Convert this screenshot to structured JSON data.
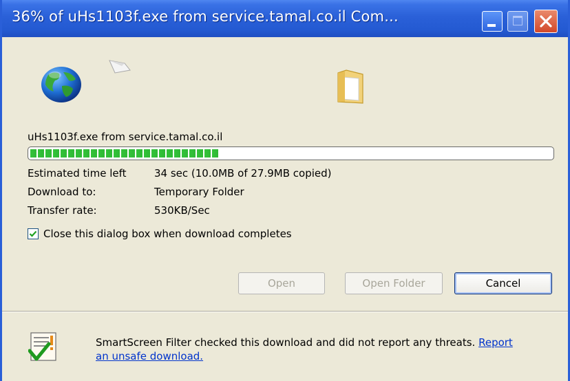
{
  "window": {
    "title": "36% of uHs1103f.exe from service.tamal.co.il Com...",
    "colors": {
      "titlebar": "#245ad2",
      "body": "#ece9d8",
      "progress": "#33c33a",
      "link": "#0033cc"
    }
  },
  "titlebar_buttons": {
    "minimize": "minimize-icon",
    "maximize": "maximize-icon",
    "close": "close-icon"
  },
  "icons": {
    "source": "globe-icon",
    "transfer": "paper-icon",
    "destination": "folder-icon",
    "smartscreen": "shield-check-icon"
  },
  "download": {
    "file_source": "uHs1103f.exe from service.tamal.co.il",
    "progress_percent": 36,
    "estimated_label": "Estimated time left",
    "estimated_value": "34 sec (10.0MB of 27.9MB copied)",
    "download_to_label": "Download to:",
    "download_to_value": "Temporary Folder",
    "rate_label": "Transfer rate:",
    "rate_value": "530KB/Sec"
  },
  "close_option": {
    "label": "Close this dialog box when download completes",
    "checked": true
  },
  "buttons": {
    "open": "Open",
    "open_folder": "Open Folder",
    "cancel": "Cancel"
  },
  "smartscreen": {
    "text": "SmartScreen Filter checked this download and did not report any threats.",
    "link": "Report an unsafe download."
  }
}
